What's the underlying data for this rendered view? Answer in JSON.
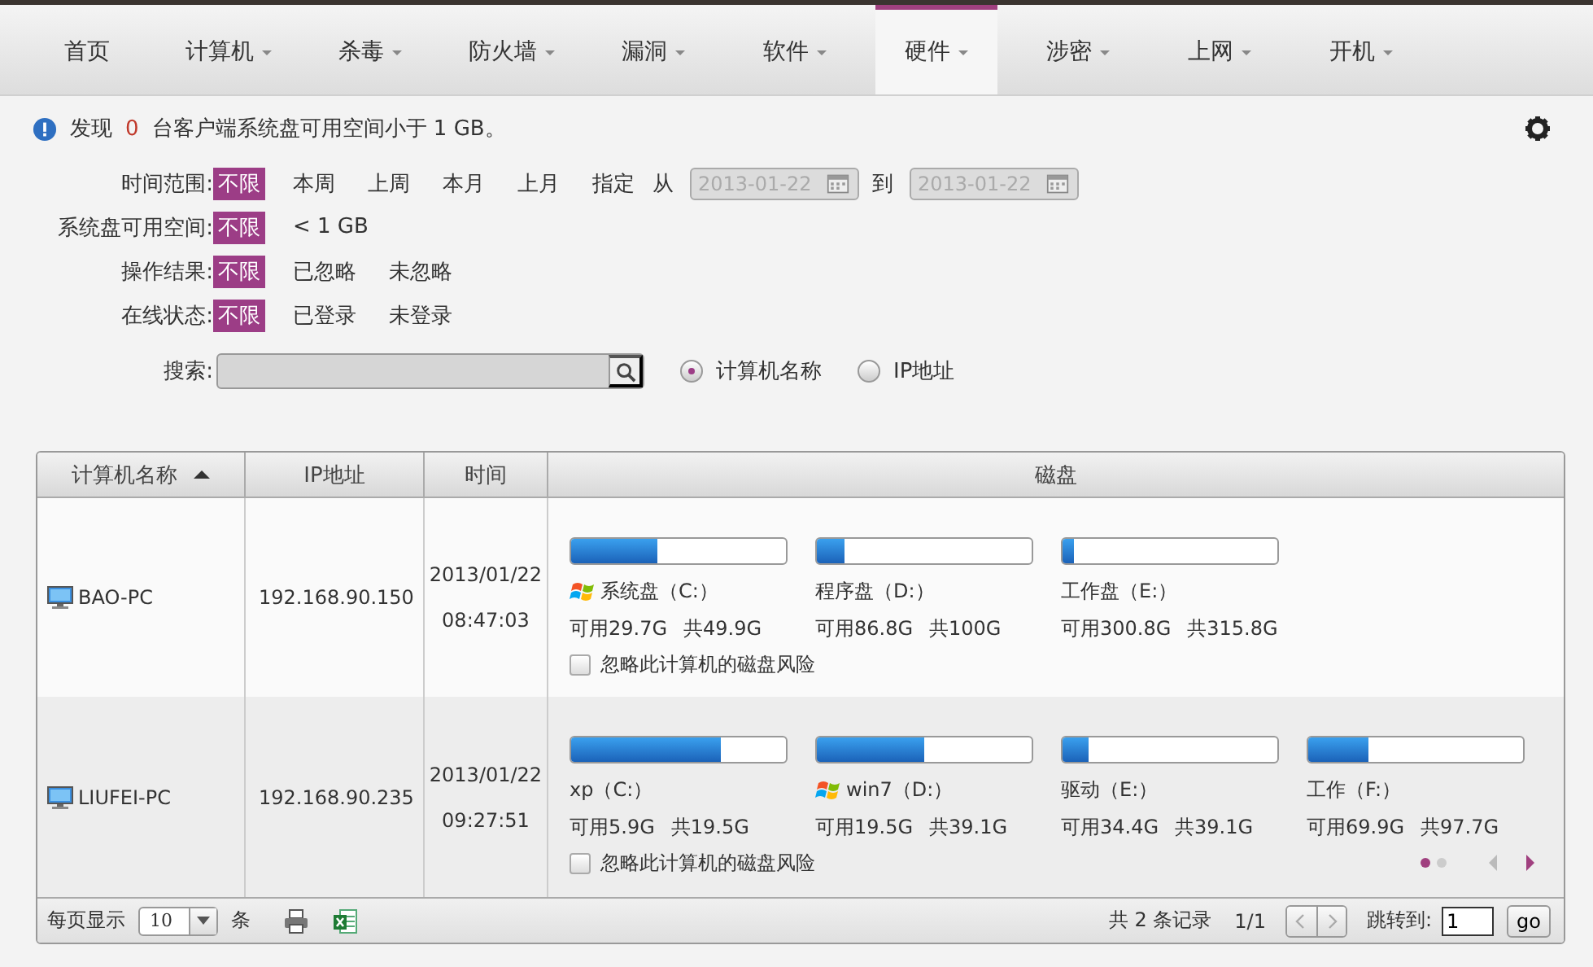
{
  "nav": {
    "tabs": [
      {
        "label": "首页",
        "has_menu": false,
        "selected": false
      },
      {
        "label": "计算机",
        "has_menu": true,
        "selected": false
      },
      {
        "label": "杀毒",
        "has_menu": true,
        "selected": false
      },
      {
        "label": "防火墙",
        "has_menu": true,
        "selected": false
      },
      {
        "label": "漏洞",
        "has_menu": true,
        "selected": false
      },
      {
        "label": "软件",
        "has_menu": true,
        "selected": false
      },
      {
        "label": "硬件",
        "has_menu": true,
        "selected": true
      },
      {
        "label": "涉密",
        "has_menu": true,
        "selected": false
      },
      {
        "label": "上网",
        "has_menu": true,
        "selected": false
      },
      {
        "label": "开机",
        "has_menu": true,
        "selected": false
      }
    ]
  },
  "notice": {
    "prefix": "发现",
    "count": "0",
    "suffix": "台客户端系统盘可用空间小于 1 GB。"
  },
  "filters": [
    {
      "label": "时间范围:",
      "options": [
        {
          "label": "不限",
          "selected": true
        },
        {
          "label": "本周",
          "selected": false
        },
        {
          "label": "上周",
          "selected": false
        },
        {
          "label": "本月",
          "selected": false
        },
        {
          "label": "上月",
          "selected": false
        },
        {
          "label": "指定",
          "selected": false
        }
      ],
      "range": {
        "from_label": "从",
        "from_value": "2013-01-22",
        "to_label": "到",
        "to_value": "2013-01-22",
        "disabled": true
      }
    },
    {
      "label": "系统盘可用空间:",
      "options": [
        {
          "label": "不限",
          "selected": true
        },
        {
          "label": "< 1 GB",
          "selected": false
        }
      ]
    },
    {
      "label": "操作结果:",
      "options": [
        {
          "label": "不限",
          "selected": true
        },
        {
          "label": "已忽略",
          "selected": false
        },
        {
          "label": "未忽略",
          "selected": false
        }
      ]
    },
    {
      "label": "在线状态:",
      "options": [
        {
          "label": "不限",
          "selected": true
        },
        {
          "label": "已登录",
          "selected": false
        },
        {
          "label": "未登录",
          "selected": false
        }
      ]
    }
  ],
  "search": {
    "label": "搜索:",
    "modes": [
      {
        "label": "计算机名称",
        "selected": true
      },
      {
        "label": "IP地址",
        "selected": false
      }
    ]
  },
  "table": {
    "columns": [
      {
        "label": "计算机名称",
        "sorted": true
      },
      {
        "label": "IP地址",
        "sorted": false
      },
      {
        "label": "时间",
        "sorted": false
      },
      {
        "label": "磁盘",
        "sorted": false
      }
    ],
    "rows": [
      {
        "name": "BAO-PC",
        "ip": "192.168.90.150",
        "date": "2013/01/22",
        "time": "08:47:03",
        "ignore_label": "忽略此计算机的磁盘风险",
        "ignored": false,
        "disks": [
          {
            "label": "系统盘（C:）",
            "system": true,
            "level": 0.4,
            "free": "可用29.7G",
            "total": "共49.9G"
          },
          {
            "label": "程序盘（D:）",
            "system": false,
            "level": 0.13,
            "free": "可用86.8G",
            "total": "共100G"
          },
          {
            "label": "工作盘（E:）",
            "system": false,
            "level": 0.05,
            "free": "可用300.8G",
            "total": "共315.8G"
          }
        ]
      },
      {
        "name": "LIUFEI-PC",
        "ip": "192.168.90.235",
        "date": "2013/01/22",
        "time": "09:27:51",
        "ignore_label": "忽略此计算机的磁盘风险",
        "ignored": false,
        "disks": [
          {
            "label": "xp（C:）",
            "system": false,
            "level": 0.7,
            "free": "可用5.9G",
            "total": "共19.5G"
          },
          {
            "label": "win7（D:）",
            "system": true,
            "level": 0.5,
            "free": "可用19.5G",
            "total": "共39.1G"
          },
          {
            "label": "驱动（E:）",
            "system": false,
            "level": 0.12,
            "free": "可用34.4G",
            "total": "共39.1G"
          },
          {
            "label": "工作（F:）",
            "system": false,
            "level": 0.28,
            "free": "可用69.9G",
            "total": "共97.7G"
          }
        ],
        "pager": {
          "dots": [
            {
              "selected": true
            },
            {
              "selected": false
            }
          ],
          "prev_disabled": true,
          "next_disabled": false
        }
      }
    ]
  },
  "footer": {
    "per_page_label": "每页显示",
    "per_page": "10",
    "per_page_unit": "条",
    "records": "共 2 条记录",
    "page": "1/1",
    "prev_disabled": true,
    "next_disabled": true,
    "jump_label": "跳转到:",
    "jump_value": "1",
    "go": "go"
  }
}
